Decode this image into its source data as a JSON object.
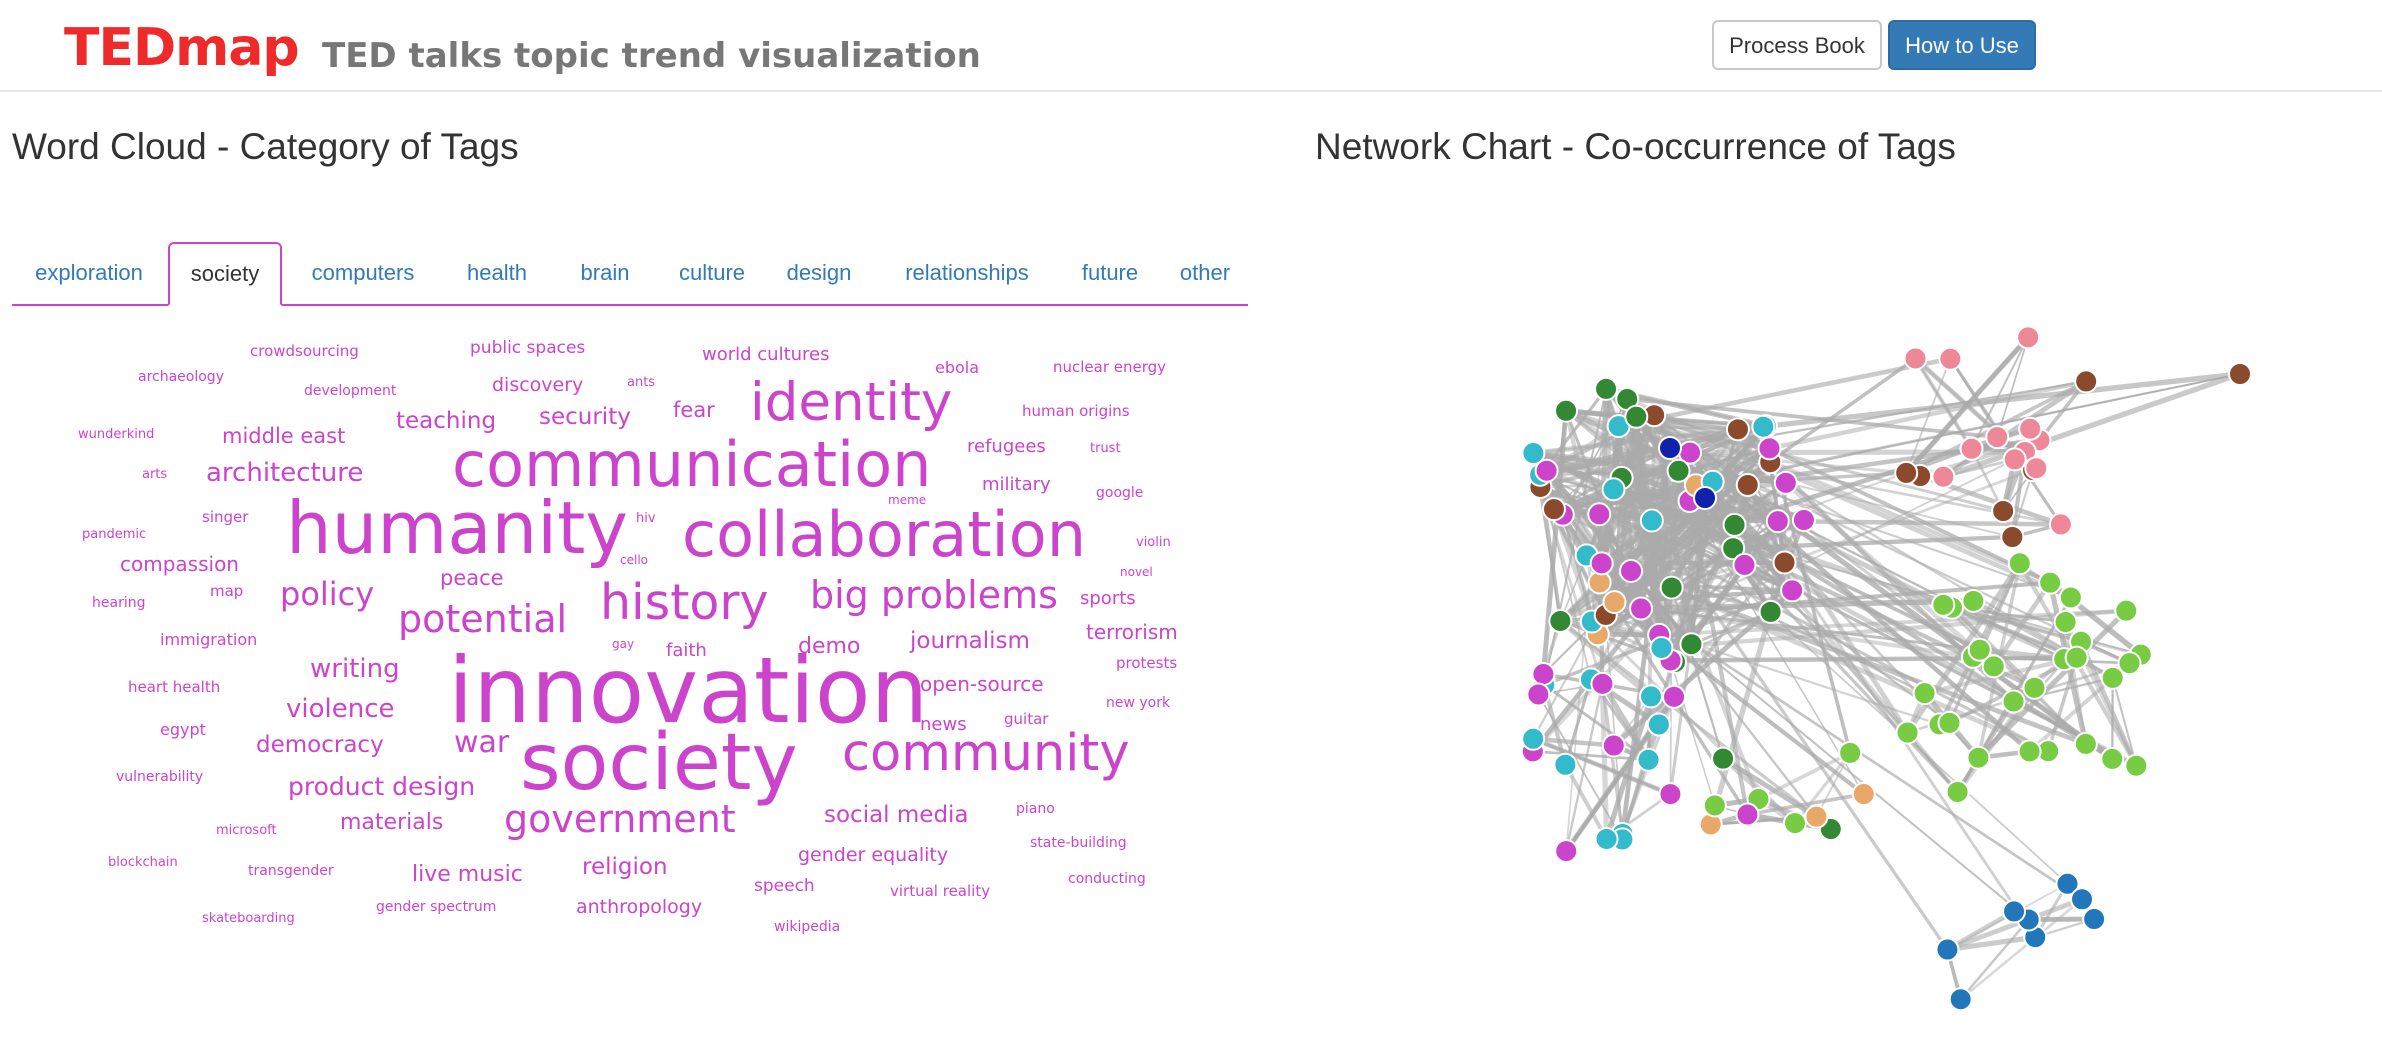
{
  "header": {
    "brand": "TEDmap",
    "tagline": "TED talks topic trend visualization",
    "process_book_label": "Process Book",
    "how_to_use_label": "How to Use"
  },
  "word_cloud": {
    "title": "Word Cloud - Category of Tags",
    "tabs": [
      "exploration",
      "society",
      "computers",
      "health",
      "brain",
      "culture",
      "design",
      "relationships",
      "future",
      "other"
    ],
    "active_tab": "society",
    "color": "#cc44cc",
    "words": [
      "crowdsourcing",
      "public spaces",
      "world cultures",
      "archaeology",
      "development",
      "discovery",
      "ants",
      "ebola",
      "nuclear energy",
      "identity",
      "teaching",
      "security",
      "fear",
      "human origins",
      "wunderkind",
      "middle east",
      "communication",
      "trust",
      "refugees",
      "arts",
      "architecture",
      "meme",
      "military",
      "google",
      "singer",
      "humanity",
      "collaboration",
      "hiv",
      "pandemic",
      "violin",
      "compassion",
      "cello",
      "novel",
      "map",
      "peace",
      "policy",
      "history",
      "big problems",
      "sports",
      "hearing",
      "potential",
      "terrorism",
      "immigration",
      "gay",
      "faith",
      "demo",
      "journalism",
      "protests",
      "writing",
      "heart health",
      "innovation",
      "open-source",
      "violence",
      "new york",
      "egypt",
      "news",
      "guitar",
      "democracy",
      "war",
      "society",
      "community",
      "vulnerability",
      "product design",
      "piano",
      "materials",
      "government",
      "social media",
      "microsoft",
      "state-building",
      "gender equality",
      "blockchain",
      "transgender",
      "live music",
      "religion",
      "conducting",
      "speech",
      "virtual reality",
      "gender spectrum",
      "anthropology",
      "skateboarding",
      "wikipedia"
    ]
  },
  "network_chart": {
    "title": "Network Chart - Co-occurrence of Tags",
    "group_colors": {
      "magenta": "#cc44cc",
      "green": "#338833",
      "light_green": "#77cc44",
      "pink": "#ee8899",
      "brown": "#8b4a2b",
      "cyan": "#33bbcc",
      "orange": "#e8a868",
      "blue": "#2277bb",
      "navy": "#1122aa"
    },
    "edge_color": "#aaaaaa"
  }
}
